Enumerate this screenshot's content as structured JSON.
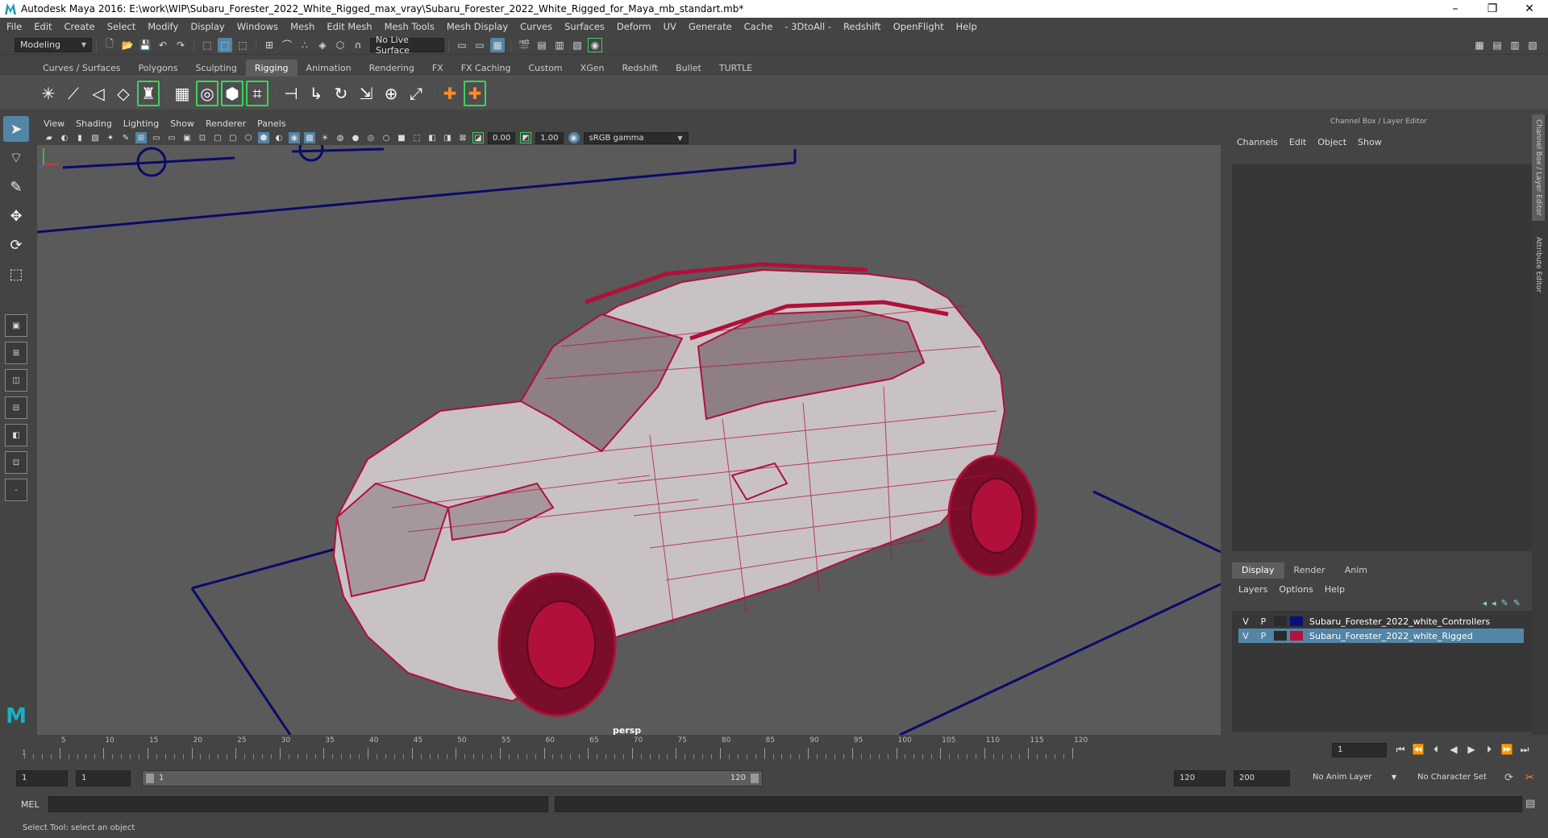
{
  "window": {
    "title": "Autodesk Maya 2016: E:\\work\\WIP\\Subaru_Forester_2022_White_Rigged_max_vray\\Subaru_Forester_2022_White_Rigged_for_Maya_mb_standart.mb*",
    "controls": [
      "–",
      "❐",
      "✕"
    ]
  },
  "menubar": [
    "File",
    "Edit",
    "Create",
    "Select",
    "Modify",
    "Display",
    "Windows",
    "Mesh",
    "Edit Mesh",
    "Mesh Tools",
    "Mesh Display",
    "Curves",
    "Surfaces",
    "Deform",
    "UV",
    "Generate",
    "Cache",
    "- 3DtoAll -",
    "Redshift",
    "OpenFlight",
    "Help"
  ],
  "statusline": {
    "mode": "Modeling",
    "live_surface": "No Live Surface"
  },
  "shelf_tabs": [
    "Curves / Surfaces",
    "Polygons",
    "Sculpting",
    "Rigging",
    "Animation",
    "Rendering",
    "FX",
    "FX Caching",
    "Custom",
    "XGen",
    "Redshift",
    "Bullet",
    "TURTLE"
  ],
  "active_shelf_tab": "Rigging",
  "viewport": {
    "menu": [
      "View",
      "Shading",
      "Lighting",
      "Show",
      "Renderer",
      "Panels"
    ],
    "exposure": "0.00",
    "gamma": "1.00",
    "color_space": "sRGB gamma",
    "camera": "persp"
  },
  "channel_box": {
    "title": "Channel Box / Layer Editor",
    "menu": [
      "Channels",
      "Edit",
      "Object",
      "Show"
    ],
    "layer_tabs": [
      "Display",
      "Render",
      "Anim"
    ],
    "active_layer_tab": "Display",
    "layer_menu": [
      "Layers",
      "Options",
      "Help"
    ],
    "layers": [
      {
        "v": "V",
        "p": "P",
        "color": "#0d0d7a",
        "name": "Subaru_Forester_2022_white_Controllers",
        "selected": false
      },
      {
        "v": "V",
        "p": "P",
        "color": "#b5123f",
        "name": "Subaru_Forester_2022_white_Rigged",
        "selected": true
      }
    ]
  },
  "side_tabs": [
    "Channel Box / Layer Editor",
    "Attribute Editor"
  ],
  "timeline": {
    "ticks": [
      5,
      10,
      15,
      20,
      25,
      30,
      35,
      40,
      45,
      50,
      55,
      60,
      65,
      70,
      75,
      80,
      85,
      90,
      95,
      100,
      105,
      110,
      115,
      120
    ],
    "start_marker": "1",
    "current_frame": "1"
  },
  "range": {
    "start": "1",
    "playback_start": "1",
    "slider_left": "1",
    "slider_right": "120",
    "playback_end": "120",
    "end": "200",
    "anim_layer": "No Anim Layer",
    "character_set": "No Character Set"
  },
  "mel_label": "MEL",
  "help_line": "Select Tool: select an object",
  "colors": {
    "wireframe": "#b0103a",
    "ground": "#0a0a6a",
    "selection": "#5285a6"
  }
}
